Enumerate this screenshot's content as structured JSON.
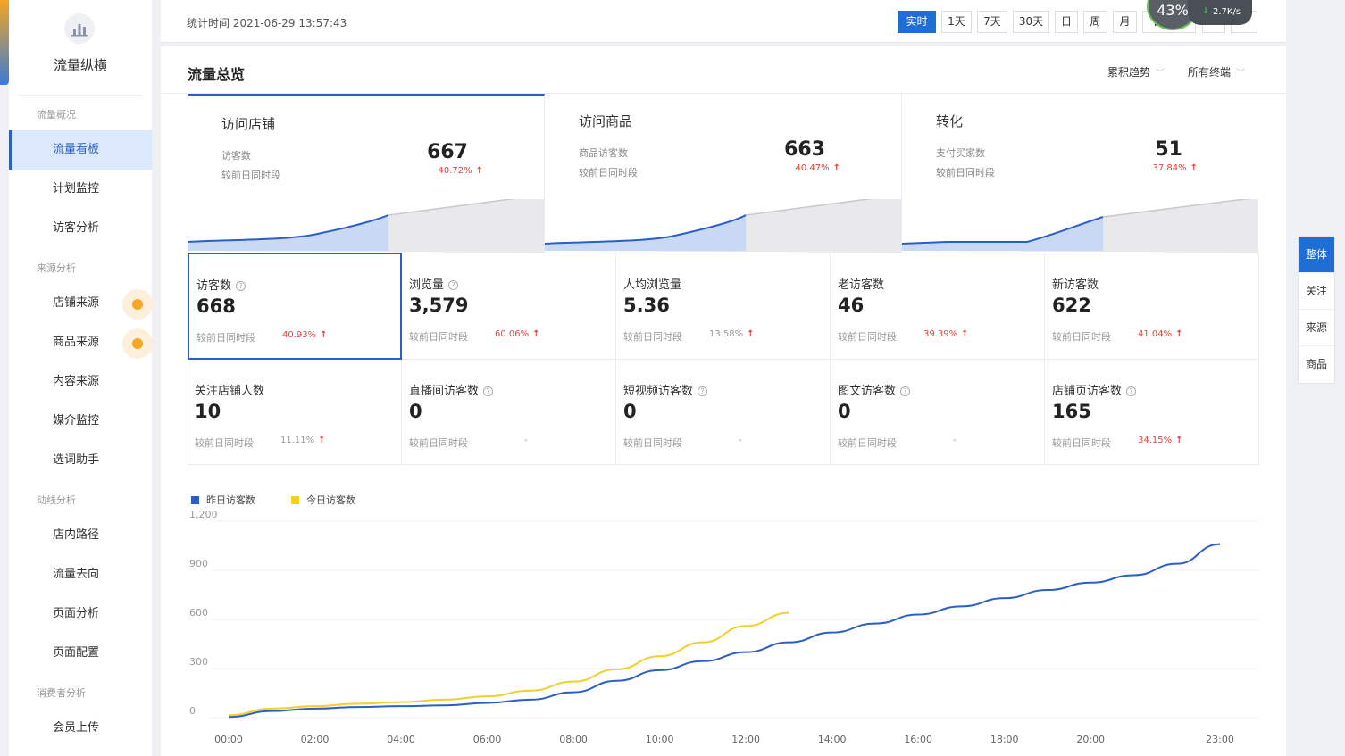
{
  "sidebar": {
    "brand": "流量纵横",
    "groups": [
      {
        "label": "流量概况"
      },
      {
        "label": "来源分析"
      },
      {
        "label": "动线分析"
      },
      {
        "label": "消费者分析"
      }
    ],
    "items": [
      {
        "label": "流量看板",
        "active": true
      },
      {
        "label": "计划监控"
      },
      {
        "label": "访客分析"
      },
      {
        "label": "店铺来源",
        "dot": true
      },
      {
        "label": "商品来源",
        "dot": true
      },
      {
        "label": "内容来源"
      },
      {
        "label": "媒介监控"
      },
      {
        "label": "选词助手"
      },
      {
        "label": "店内路径"
      },
      {
        "label": "流量去向"
      },
      {
        "label": "页面分析"
      },
      {
        "label": "页面配置"
      },
      {
        "label": "会员上传"
      }
    ]
  },
  "topbar": {
    "stat_time": "统计时间 2021-06-29 13:57:43",
    "ranges": [
      "实时",
      "1天",
      "7天",
      "30天",
      "日",
      "周",
      "月",
      "自定义"
    ],
    "active_range": "实时",
    "nav_prev": "<",
    "nav_next": ">",
    "speed_percent": "43%",
    "speed_rate": "2.7K/s"
  },
  "main": {
    "title": "流量总览",
    "trend_dropdown": "累积趋势",
    "terminal_dropdown": "所有终端"
  },
  "overview": [
    {
      "title": "访问店铺",
      "label": "访客数",
      "compare": "较前日同时段",
      "value": "667",
      "pct": "40.72%"
    },
    {
      "title": "访问商品",
      "label": "商品访客数",
      "compare": "较前日同时段",
      "value": "663",
      "pct": "40.47%"
    },
    {
      "title": "转化",
      "label": "支付买家数",
      "compare": "较前日同时段",
      "value": "51",
      "pct": "37.84%"
    }
  ],
  "metrics": [
    {
      "label": "访客数",
      "help": true,
      "value": "668",
      "compare": "较前日同时段",
      "pct": "40.93%",
      "up": true
    },
    {
      "label": "浏览量",
      "help": true,
      "value": "3,579",
      "compare": "较前日同时段",
      "pct": "60.06%",
      "up": true
    },
    {
      "label": "人均浏览量",
      "help": false,
      "value": "5.36",
      "compare": "较前日同时段",
      "pct": "13.58%",
      "up": true
    },
    {
      "label": "老访客数",
      "help": false,
      "value": "46",
      "compare": "较前日同时段",
      "pct": "39.39%",
      "up": true
    },
    {
      "label": "新访客数",
      "help": false,
      "value": "622",
      "compare": "较前日同时段",
      "pct": "41.04%",
      "up": true
    },
    {
      "label": "关注店铺人数",
      "help": false,
      "value": "10",
      "compare": "较前日同时段",
      "pct": "11.11%",
      "up": true
    },
    {
      "label": "直播间访客数",
      "help": true,
      "value": "0",
      "compare": "较前日同时段",
      "pct": "-",
      "up": false
    },
    {
      "label": "短视频访客数",
      "help": true,
      "value": "0",
      "compare": "较前日同时段",
      "pct": "-",
      "up": false
    },
    {
      "label": "图文访客数",
      "help": true,
      "value": "0",
      "compare": "较前日同时段",
      "pct": "-",
      "up": false
    },
    {
      "label": "店铺页访客数",
      "help": true,
      "value": "165",
      "compare": "较前日同时段",
      "pct": "34.15%",
      "up": true
    }
  ],
  "float_tabs": [
    {
      "label": "整体",
      "active": true
    },
    {
      "label": "关注"
    },
    {
      "label": "来源"
    },
    {
      "label": "商品"
    }
  ],
  "colors": {
    "accent": "#1f6ed4",
    "yesterday": "#2b5fc6",
    "today": "#f2cf2e",
    "up": "#e0443c"
  },
  "chart_data": {
    "type": "line",
    "x": [
      "00:00",
      "01:00",
      "02:00",
      "03:00",
      "04:00",
      "05:00",
      "06:00",
      "07:00",
      "08:00",
      "09:00",
      "10:00",
      "11:00",
      "12:00",
      "13:00",
      "14:00",
      "15:00",
      "16:00",
      "17:00",
      "18:00",
      "19:00",
      "20:00",
      "21:00",
      "22:00",
      "23:00"
    ],
    "x_ticks": [
      "00:00",
      "02:00",
      "04:00",
      "06:00",
      "08:00",
      "10:00",
      "12:00",
      "14:00",
      "16:00",
      "18:00",
      "20:00",
      "23:00"
    ],
    "series": [
      {
        "name": "昨日访客数",
        "values": [
          5,
          40,
          55,
          65,
          70,
          75,
          90,
          110,
          155,
          225,
          290,
          345,
          400,
          460,
          520,
          575,
          630,
          680,
          730,
          780,
          825,
          870,
          940,
          1060
        ]
      },
      {
        "name": "今日访客数",
        "values": [
          15,
          55,
          70,
          85,
          95,
          110,
          130,
          165,
          220,
          295,
          375,
          460,
          560,
          640
        ]
      }
    ],
    "y_ticks": [
      0,
      300,
      600,
      900,
      1200
    ],
    "ylim": [
      0,
      1200
    ],
    "legend": "top-left"
  }
}
